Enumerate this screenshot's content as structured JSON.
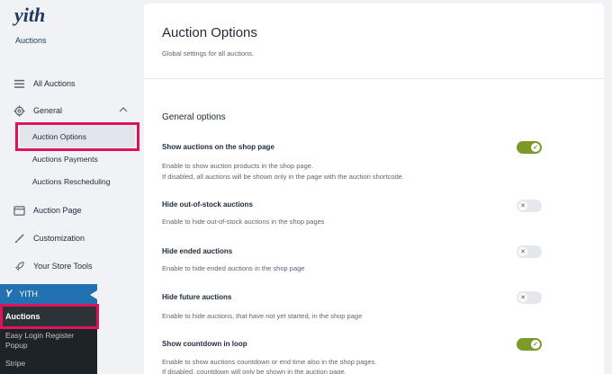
{
  "brand": {
    "logo_text": "yith",
    "subtitle": "Auctions",
    "accent": "#1e3a5c",
    "highlight": "#e0125c",
    "toggle_on": "#7c9a2a"
  },
  "sidebar": {
    "items": [
      {
        "label": "All Auctions",
        "icon": "list-icon"
      },
      {
        "label": "General",
        "icon": "gear-icon",
        "expanded": true
      },
      {
        "label": "Auction Page",
        "icon": "page-icon"
      },
      {
        "label": "Customization",
        "icon": "brush-icon"
      },
      {
        "label": "Your Store Tools",
        "icon": "rocket-icon"
      }
    ],
    "general_sub": [
      "Auction Options",
      "Auctions Payments",
      "Auctions Rescheduling"
    ],
    "active_sub": "Auction Options"
  },
  "wp_menu": {
    "parent": "YITH",
    "active": "Auctions",
    "items": [
      "Easy Login Register Popup",
      "Stripe"
    ]
  },
  "main": {
    "title": "Auction Options",
    "subtitle": "Global settings for all auctions.",
    "section": "General options",
    "options": [
      {
        "title": "Show auctions on the shop page",
        "desc1": "Enable to show auction products in the shop page.",
        "desc2": "If disabled, all auctions will be shown only in the page with the auction shortcode.",
        "enabled": true
      },
      {
        "title": "Hide out-of-stock auctions",
        "desc1": "Enable to hide out-of-stock auctions in the shop pages",
        "desc2": "",
        "enabled": false
      },
      {
        "title": "Hide ended auctions",
        "desc1": "Enable to hide ended auctions in the shop page",
        "desc2": "",
        "enabled": false
      },
      {
        "title": "Hide future auctions",
        "desc1": "Enable to hide auctions, that have not yet started, in the shop page",
        "desc2": "",
        "enabled": false
      },
      {
        "title": "Show countdown in loop",
        "desc1": "Enable to show auctions countdown or end time also in the shop pages.",
        "desc2": "If disabled, countdown will only be shown in the auction page.",
        "enabled": true
      }
    ]
  }
}
